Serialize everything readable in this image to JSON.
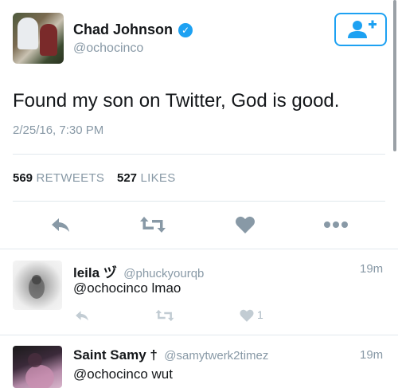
{
  "tweet": {
    "author_name": "Chad Johnson",
    "author_handle": "@ochocinco",
    "text": "Found my son on Twitter, God is good.",
    "timestamp": "2/25/16, 7:30 PM",
    "retweets_count": "569",
    "retweets_label": "RETWEETS",
    "likes_count": "527",
    "likes_label": "LIKES",
    "verified_icon": "verified-badge-icon",
    "follow_icon": "add-user-icon"
  },
  "actions": {
    "reply_icon": "reply-icon",
    "retweet_icon": "retweet-icon",
    "like_icon": "heart-icon",
    "more_icon": "more-dots-icon"
  },
  "replies": [
    {
      "name": "leila ヅ",
      "handle": "@phuckyourqb",
      "time": "19m",
      "text": "@ochocinco lmao",
      "like_count": "1"
    },
    {
      "name": "Saint Samy †",
      "handle": "@samytwerk2timez",
      "time": "19m",
      "text": "@ochocinco wut"
    }
  ],
  "colors": {
    "accent": "#1da1f2",
    "secondary_text": "#8899a6",
    "icon_gray": "#8899a6",
    "divider": "#e1e8ed"
  }
}
